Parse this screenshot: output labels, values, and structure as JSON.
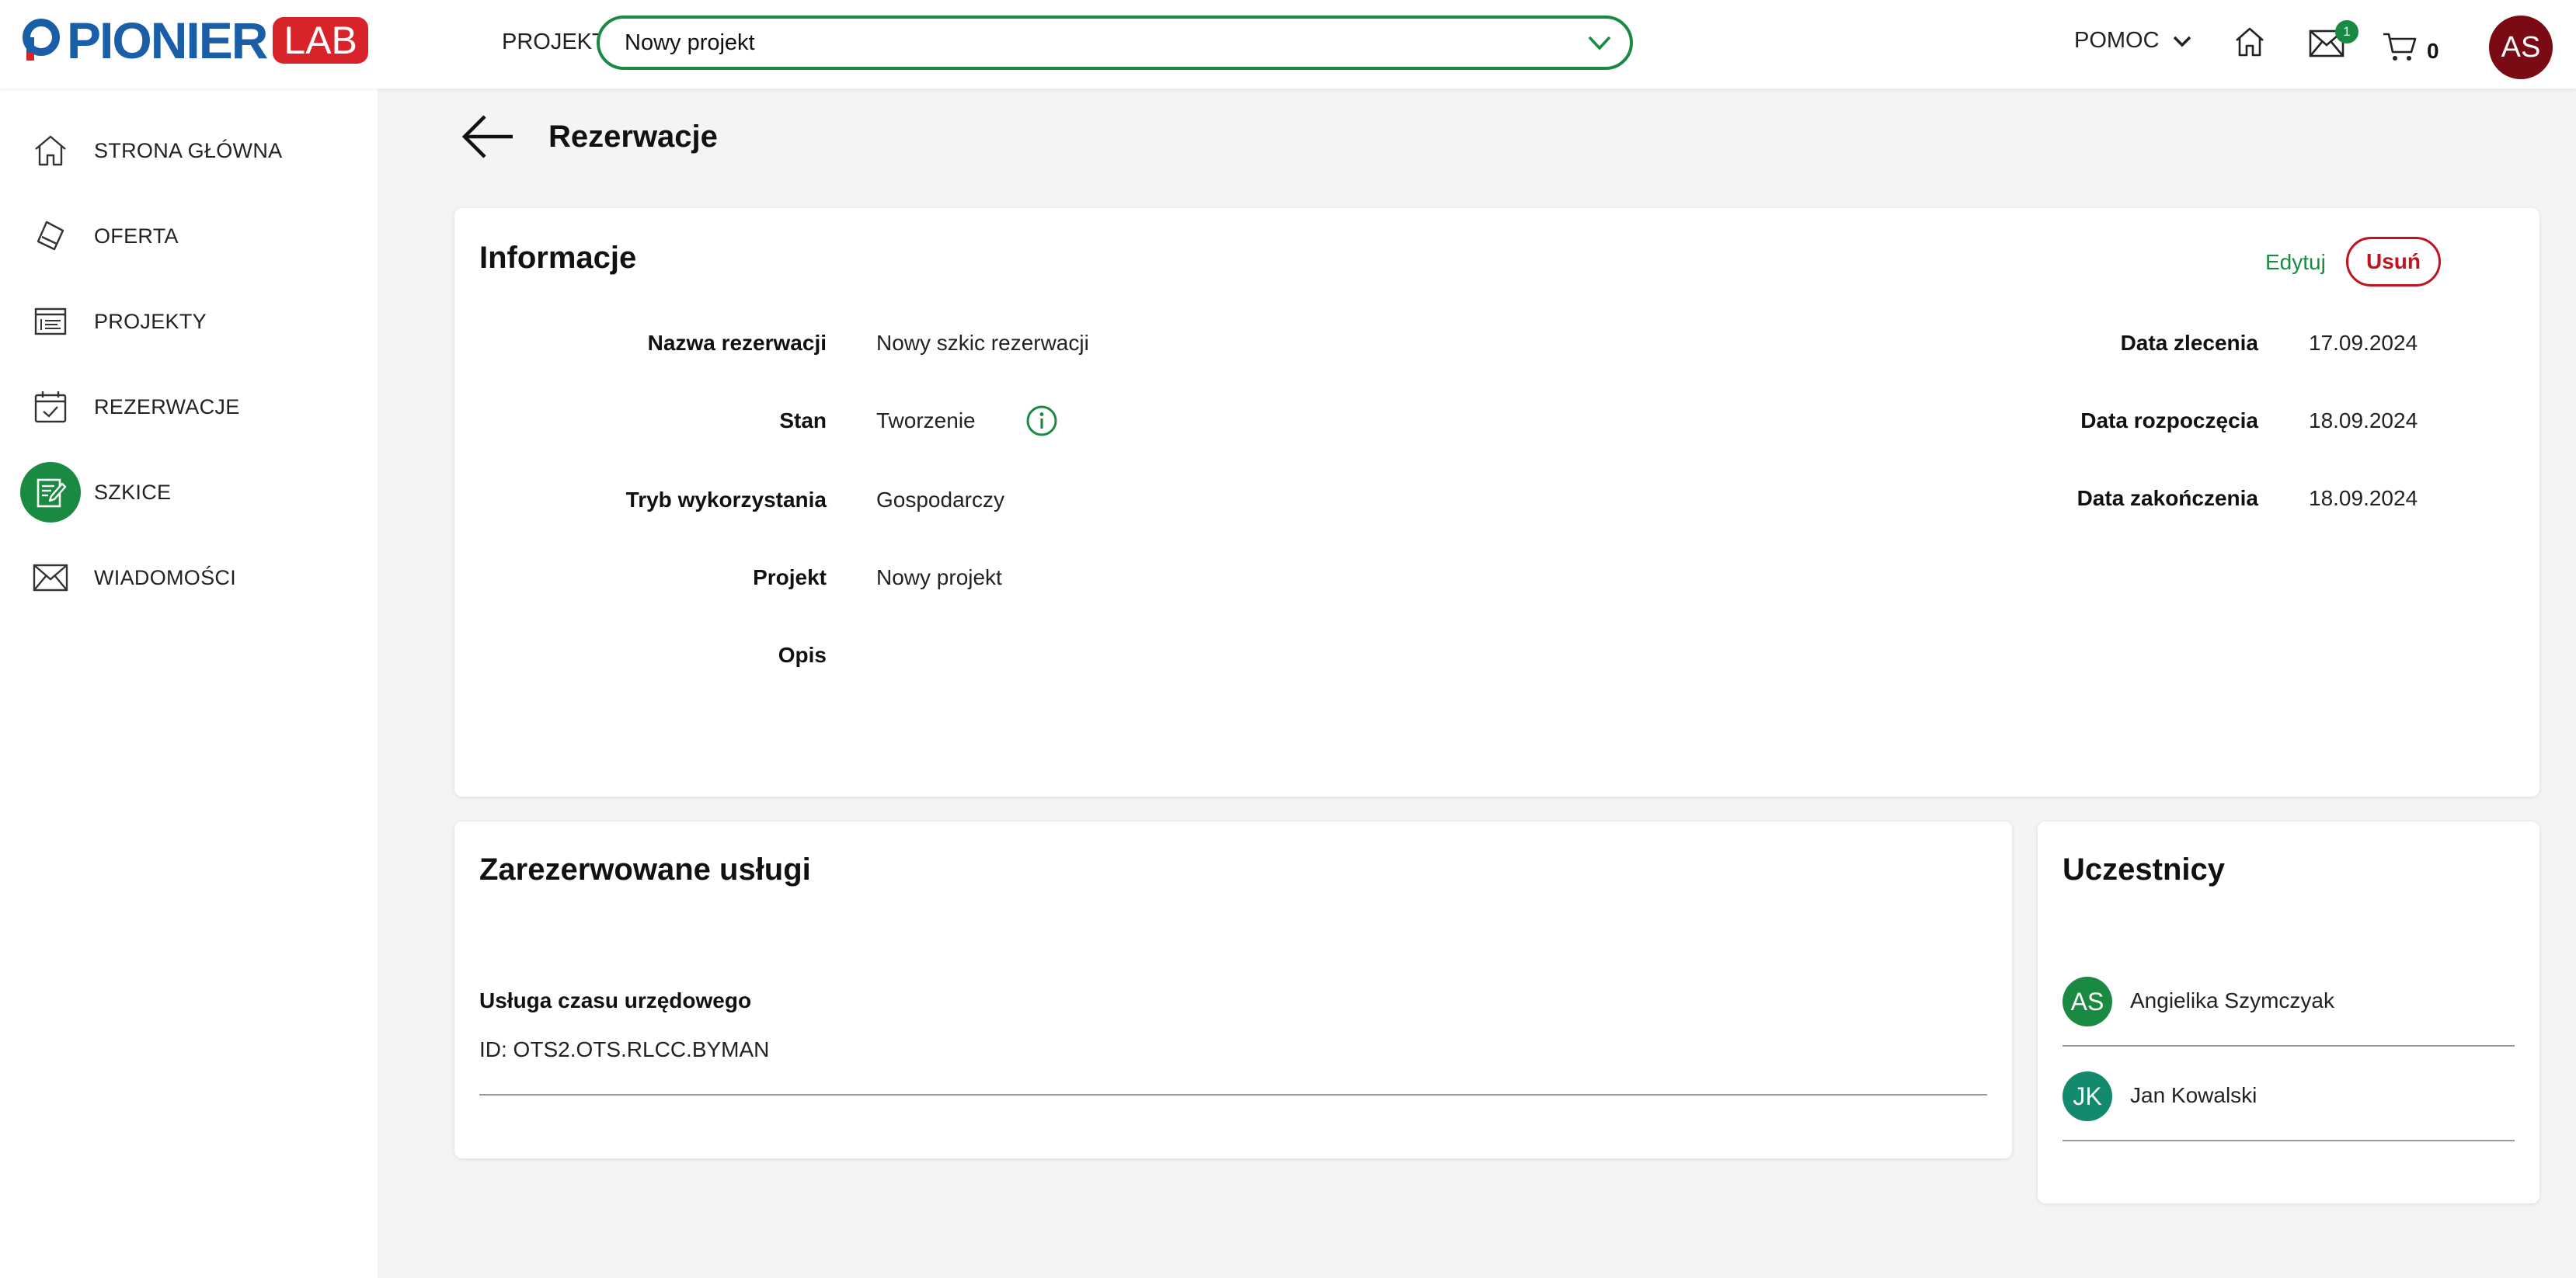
{
  "header": {
    "logo_text": "PIONIER",
    "logo_badge": "LAB",
    "project_label": "PROJEKT",
    "project_selected": "Nowy projekt",
    "help_label": "POMOC",
    "messages_badge": "1",
    "cart_count": "0",
    "user_initials": "AS"
  },
  "sidebar": {
    "items": [
      {
        "label": "STRONA GŁÓWNA",
        "icon": "home-icon"
      },
      {
        "label": "OFERTA",
        "icon": "tag-icon"
      },
      {
        "label": "PROJEKTY",
        "icon": "projects-icon"
      },
      {
        "label": "REZERWACJE",
        "icon": "calendar-check-icon"
      },
      {
        "label": "SZKICE",
        "icon": "draft-edit-icon",
        "active": true
      },
      {
        "label": "WIADOMOŚCI",
        "icon": "envelope-icon"
      }
    ]
  },
  "page": {
    "title": "Rezerwacje"
  },
  "info": {
    "title": "Informacje",
    "edit_label": "Edytuj",
    "delete_label": "Usuń",
    "left_fields": [
      {
        "label": "Nazwa rezerwacji",
        "value": "Nowy szkic rezerwacji"
      },
      {
        "label": "Stan",
        "value": "Tworzenie"
      },
      {
        "label": "Tryb wykorzystania",
        "value": "Gospodarczy"
      },
      {
        "label": "Projekt",
        "value": "Nowy projekt"
      },
      {
        "label": "Opis",
        "value": ""
      }
    ],
    "right_fields": [
      {
        "label": "Data zlecenia",
        "value": "17.09.2024"
      },
      {
        "label": "Data rozpoczęcia",
        "value": "18.09.2024"
      },
      {
        "label": "Data zakończenia",
        "value": "18.09.2024"
      }
    ]
  },
  "services": {
    "title": "Zarezerwowane usługi",
    "items": [
      {
        "name": "Usługa czasu urzędowego",
        "id": "ID: OTS2.OTS.RLCC.BYMAN"
      }
    ]
  },
  "participants": {
    "title": "Uczestnicy",
    "items": [
      {
        "initials": "AS",
        "name": "Angielika Szymczyak",
        "color": "#1a8a43"
      },
      {
        "initials": "JK",
        "name": "Jan Kowalski",
        "color": "#138a6e"
      }
    ]
  },
  "colors": {
    "accent_green": "#1a8a43",
    "danger_red": "#c0121f",
    "brand_blue": "#1b5ea8",
    "brand_red": "#d8232a"
  }
}
